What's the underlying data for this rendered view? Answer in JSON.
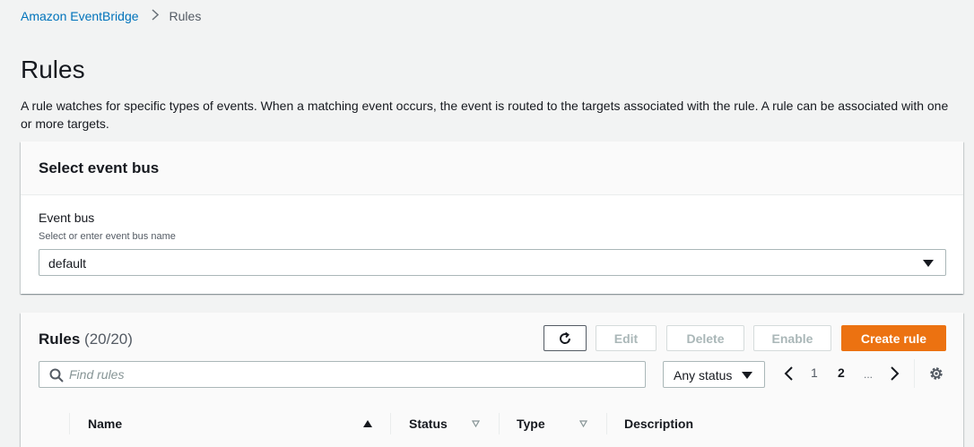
{
  "breadcrumb": {
    "items": [
      "Amazon EventBridge",
      "Rules"
    ]
  },
  "page": {
    "title": "Rules",
    "description": "A rule watches for specific types of events. When a matching event occurs, the event is routed to the targets associated with the rule. A rule can be associated with one or more targets."
  },
  "event_bus_panel": {
    "title": "Select event bus",
    "field_label": "Event bus",
    "field_description": "Select or enter event bus name",
    "selected_value": "default"
  },
  "rules_panel": {
    "title": "Rules",
    "count": "(20/20)",
    "buttons": {
      "refresh_icon": "refresh-icon",
      "edit": "Edit",
      "delete": "Delete",
      "enable": "Enable",
      "create": "Create rule"
    },
    "search": {
      "placeholder": "Find rules",
      "value": ""
    },
    "status_filter": "Any status",
    "pagination": {
      "pages": [
        "1",
        "2"
      ],
      "current_page": "2",
      "ellipsis": "..."
    },
    "columns": [
      "Name",
      "Status",
      "Type",
      "Description"
    ],
    "sort": {
      "column": "Name",
      "direction": "ascending"
    }
  },
  "colors": {
    "link": "#0073bb",
    "primary_button": "#ec7211",
    "background": "#f2f3f3",
    "disabled_text": "#aab7b8"
  }
}
